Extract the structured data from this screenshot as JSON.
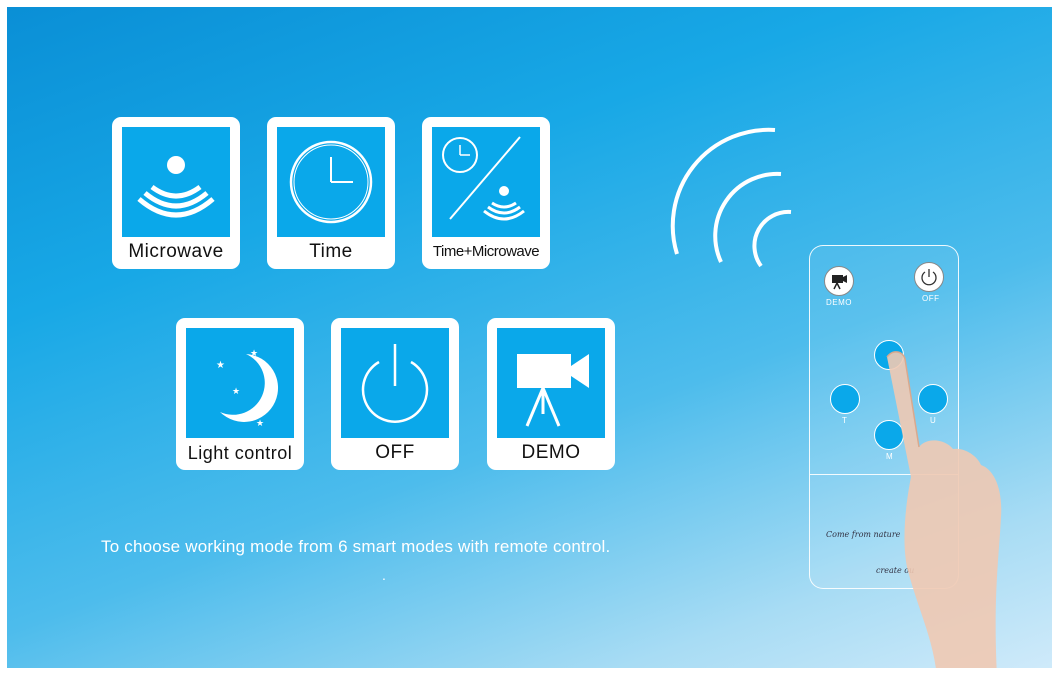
{
  "modes": [
    {
      "label": "Microwave",
      "icon": "microwave-sensor-icon"
    },
    {
      "label": "Time",
      "icon": "clock-icon"
    },
    {
      "label": "Time+Microwave",
      "icon": "clock-microwave-icon"
    },
    {
      "label": "Light control",
      "icon": "moon-stars-icon"
    },
    {
      "label": "OFF",
      "icon": "power-icon"
    },
    {
      "label": "DEMO",
      "icon": "camera-icon"
    }
  ],
  "caption": "To choose working mode from 6 smart modes with remote control.",
  "caption_dot": ".",
  "remote": {
    "demo_label": "DEMO",
    "off_label": "OFF",
    "t_label": "T",
    "u_label": "U",
    "m_label": "M",
    "script_1": "Come from nature",
    "script_2": "create ou"
  },
  "colors": {
    "tile_blue": "#0aa8ea",
    "background": "#18a8e6"
  }
}
